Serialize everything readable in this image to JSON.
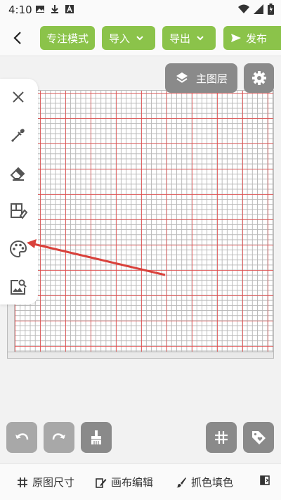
{
  "status_bar": {
    "time": "4:10",
    "left_icons": [
      "image-icon",
      "download-icon",
      "a-icon"
    ],
    "right_icons": [
      "wifi-icon",
      "signal-icon",
      "battery-icon"
    ]
  },
  "toolbar": {
    "focus_mode": "专注模式",
    "import": "导入",
    "export": "导出",
    "publish": "发布"
  },
  "layer": {
    "main_layer": "主图层"
  },
  "tools": [
    "close-icon",
    "eyedropper-icon",
    "eraser-icon",
    "fill-shape-icon",
    "palette-icon",
    "image-search-icon"
  ],
  "bottom_tabs": {
    "original_size": "原图尺寸",
    "canvas_edit": "画布编辑",
    "pick_fill": "抓色填色"
  },
  "colors": {
    "accent": "#8bc34a",
    "button_gray": "#8a8a8a",
    "grid_major": "#e64646",
    "annotation": "#d9413b"
  }
}
